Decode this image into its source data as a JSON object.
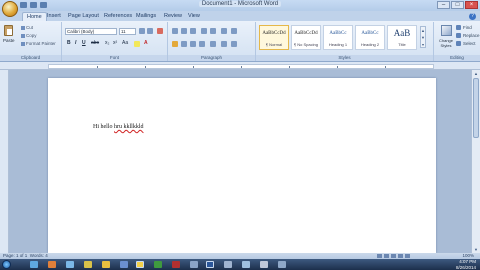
{
  "window": {
    "title": "Document1 - Microsoft Word"
  },
  "tabs": [
    "Home",
    "Insert",
    "Page Layout",
    "References",
    "Mailings",
    "Review",
    "View"
  ],
  "clipboard": {
    "paste": "Paste",
    "cut": "Cut",
    "copy": "Copy",
    "format_painter": "Format Painter",
    "label": "Clipboard"
  },
  "font": {
    "name": "Calibri (Body)",
    "size": "11",
    "label": "Font"
  },
  "paragraph": {
    "label": "Paragraph"
  },
  "styles": {
    "label": "Styles",
    "items": [
      {
        "sample": "AaBbCcDd",
        "name": "¶ Normal"
      },
      {
        "sample": "AaBbCcDd",
        "name": "¶ No Spacing"
      },
      {
        "sample": "AaBbCc",
        "name": "Heading 1"
      },
      {
        "sample": "AaBbCc",
        "name": "Heading 2"
      },
      {
        "sample": "AaB",
        "name": "Title"
      }
    ],
    "change_styles": "Change Styles"
  },
  "editing": {
    "find": "Find",
    "replace": "Replace",
    "select": "Select",
    "label": "Editing"
  },
  "document": {
    "text_plain": "Hi hello ",
    "text_error": "hru kkllkkld"
  },
  "status": {
    "page": "Page: 1 of 1",
    "words": "Words: 4",
    "zoom": "100%"
  },
  "tray": {
    "time": "4:07 PM",
    "date": "8/26/2014"
  }
}
